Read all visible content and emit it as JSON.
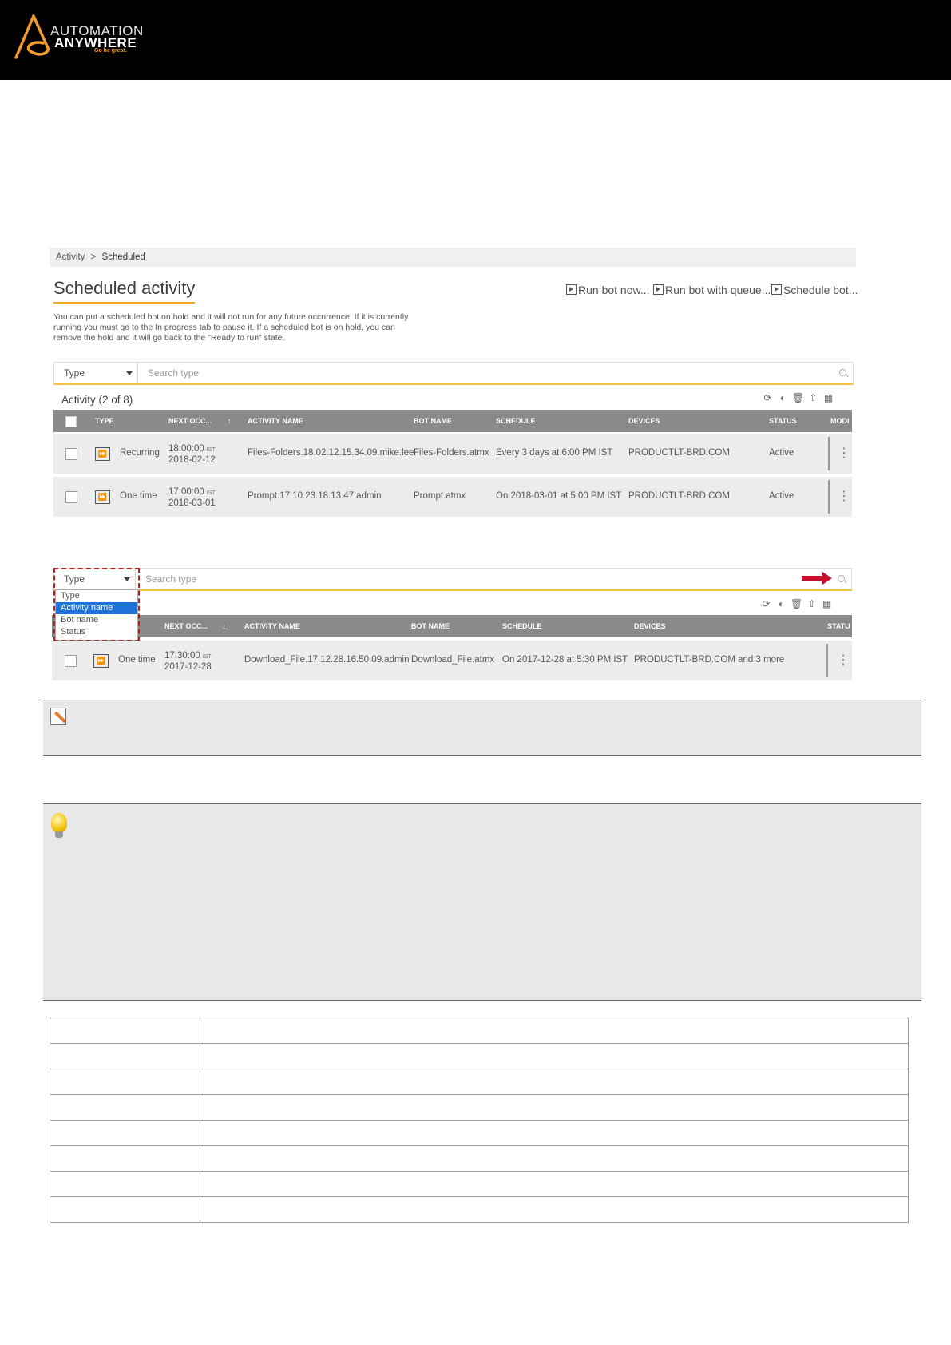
{
  "header": {
    "logo_line1": "AUTOMATION",
    "logo_line2": "ANYWHERE",
    "tagline": "Go be great."
  },
  "screenshot1": {
    "breadcrumb": [
      "Activity",
      ">",
      "Scheduled"
    ],
    "title": "Scheduled activity",
    "actions": [
      "Run bot now...",
      "Run bot with queue...",
      "Schedule bot..."
    ],
    "intro": "You can put a scheduled bot on hold and it will not run for any future occurrence. If it is currently running you must go to the In progress tab to pause it. If a scheduled bot is on hold, you can remove the hold and it will go back to the \"Ready to run\" state.",
    "filter_label": "Type",
    "search_placeholder": "Search type",
    "count_label": "Activity (2 of 8)",
    "columns": [
      "TYPE",
      "NEXT OCC...",
      "↑",
      "ACTIVITY NAME",
      "BOT NAME",
      "SCHEDULE",
      "DEVICES",
      "STATUS",
      "MODI"
    ],
    "rows": [
      {
        "type": "Recurring",
        "time": "18:00:00",
        "tz": "IST",
        "date": "2018-02-12",
        "activity": "Files-Folders.18.02.12.15.34.09.mike.lee",
        "bot": "Files-Folders.atmx",
        "schedule": "Every 3 days at 6:00 PM IST",
        "devices": "PRODUCTLT-BRD.COM",
        "status": "Active"
      },
      {
        "type": "One time",
        "time": "17:00:00",
        "tz": "IST",
        "date": "2018-03-01",
        "activity": "Prompt.17.10.23.18.13.47.admin",
        "bot": "Prompt.atmx",
        "schedule": "On 2018-03-01 at 5:00 PM IST",
        "devices": "PRODUCTLT-BRD.COM",
        "status": "Active"
      }
    ]
  },
  "screenshot2": {
    "filter_label": "Type",
    "search_placeholder": "Search type",
    "dropdown_options": [
      "Type",
      "Activity name",
      "Bot name",
      "Status"
    ],
    "selected_option": "Activity name",
    "columns": [
      "NEXT OCC...",
      "↓̲",
      "ACTIVITY NAME",
      "BOT NAME",
      "SCHEDULE",
      "DEVICES",
      "STATU"
    ],
    "row": {
      "type": "One time",
      "time": "17:30:00",
      "tz": "IST",
      "date": "2017-12-28",
      "activity": "Download_File.17.12.28.16.50.09.admin",
      "bot": "Download_File.atmx",
      "schedule": "On 2017-12-28 at 5:30 PM IST",
      "devices": "PRODUCTLT-BRD.COM and 3 more"
    }
  },
  "colors": {
    "accent": "#f5a623",
    "header_bg": "#000000",
    "table_header": "#8a8a8a",
    "selection": "#1e73d8",
    "callout": "#b22222"
  },
  "icons": [
    "pencil-note-icon",
    "lightbulb-tip-icon",
    "refresh-icon",
    "toggle-icon",
    "trash-icon",
    "export-icon",
    "columns-icon",
    "search-icon",
    "more-icon"
  ]
}
